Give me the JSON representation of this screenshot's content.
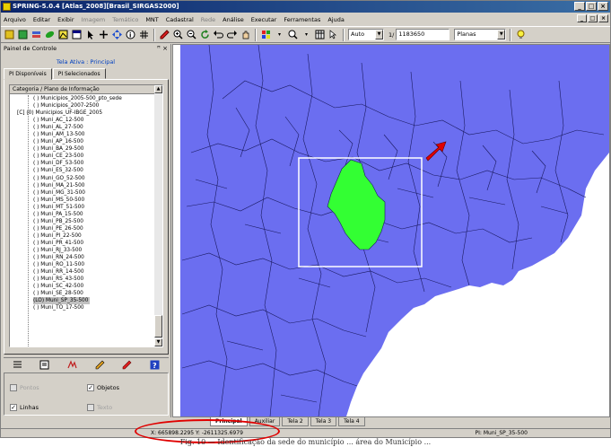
{
  "window": {
    "title": "SPRING-5.0.4 [Atlas_2008][Brasil_SIRGAS2000]",
    "controls": [
      "_",
      "□",
      "×"
    ],
    "mdi_controls": [
      "_",
      "□",
      "×"
    ]
  },
  "menu": [
    "Arquivo",
    "Editar",
    "Exibir",
    "Imagem",
    "Temático",
    "MNT",
    "Cadastral",
    "Rede",
    "Análise",
    "Executar",
    "Ferramentas",
    "Ajuda"
  ],
  "menu_disabled": [
    false,
    false,
    false,
    true,
    true,
    false,
    false,
    true,
    false,
    false,
    false,
    false
  ],
  "toolbar": {
    "mode_value": "Auto",
    "scale_prefix": "1/",
    "scale_value": "1183650",
    "view_value": "Planas"
  },
  "panel": {
    "title": "Painel de Controle",
    "pin": "ꟸ ×",
    "active_label": "Tela Ativa : Principal",
    "tabs": [
      "PI Disponíveis",
      "PI Selecionados"
    ],
    "tree_header": "Categoria / Plano de Informação",
    "tree_items": [
      {
        "label": "( ) Municipios_2005-500_pto_sede",
        "indent": 1,
        "selected": false
      },
      {
        "label": "( ) Municipios_2007-2500",
        "indent": 1,
        "selected": false
      },
      {
        "label": "[C] (0) Municipios_UF-IBGE_2005",
        "indent": 0,
        "selected": false
      },
      {
        "label": "( ) Muni_AC_12-500",
        "indent": 1,
        "selected": false
      },
      {
        "label": "( ) Muni_AL_27-500",
        "indent": 1,
        "selected": false
      },
      {
        "label": "( ) Muni_AM_13-500",
        "indent": 1,
        "selected": false
      },
      {
        "label": "( ) Muni_AP_16-500",
        "indent": 1,
        "selected": false
      },
      {
        "label": "( ) Muni_BA_29-500",
        "indent": 1,
        "selected": false
      },
      {
        "label": "( ) Muni_CE_23-500",
        "indent": 1,
        "selected": false
      },
      {
        "label": "( ) Muni_DF_53-500",
        "indent": 1,
        "selected": false
      },
      {
        "label": "( ) Muni_ES_32-500",
        "indent": 1,
        "selected": false
      },
      {
        "label": "( ) Muni_GO_52-500",
        "indent": 1,
        "selected": false
      },
      {
        "label": "( ) Muni_MA_21-500",
        "indent": 1,
        "selected": false
      },
      {
        "label": "( ) Muni_MG_31-500",
        "indent": 1,
        "selected": false
      },
      {
        "label": "( ) Muni_MS_50-500",
        "indent": 1,
        "selected": false
      },
      {
        "label": "( ) Muni_MT_51-500",
        "indent": 1,
        "selected": false
      },
      {
        "label": "( ) Muni_PA_15-500",
        "indent": 1,
        "selected": false
      },
      {
        "label": "( ) Muni_PB_25-500",
        "indent": 1,
        "selected": false
      },
      {
        "label": "( ) Muni_PE_26-500",
        "indent": 1,
        "selected": false
      },
      {
        "label": "( ) Muni_PI_22-500",
        "indent": 1,
        "selected": false
      },
      {
        "label": "( ) Muni_PR_41-500",
        "indent": 1,
        "selected": false
      },
      {
        "label": "( ) Muni_RJ_33-500",
        "indent": 1,
        "selected": false
      },
      {
        "label": "( ) Muni_RN_24-500",
        "indent": 1,
        "selected": false
      },
      {
        "label": "( ) Muni_RO_11-500",
        "indent": 1,
        "selected": false
      },
      {
        "label": "( ) Muni_RR_14-500",
        "indent": 1,
        "selected": false
      },
      {
        "label": "( ) Muni_RS_43-500",
        "indent": 1,
        "selected": false
      },
      {
        "label": "( ) Muni_SC_42-500",
        "indent": 1,
        "selected": false
      },
      {
        "label": "( ) Muni_SE_28-500",
        "indent": 1,
        "selected": false
      },
      {
        "label": "(LO) Muni_SP_35-500",
        "indent": 1,
        "selected": true
      },
      {
        "label": "( ) Muni_TO_17-500",
        "indent": 1,
        "selected": false
      }
    ],
    "checkboxes": {
      "pontos": {
        "label": "Pontos",
        "checked": false,
        "enabled": false
      },
      "objetos": {
        "label": "Objetos",
        "checked": true,
        "enabled": true
      },
      "linhas": {
        "label": "Linhas",
        "checked": true,
        "enabled": true
      },
      "texto": {
        "label": "Texto",
        "checked": false,
        "enabled": false
      }
    }
  },
  "map": {
    "fill_color": "#6b6ef0",
    "highlight_color": "#33ff33",
    "selection_box_color": "#ffffff",
    "arrow_color": "#e00000",
    "tabs": [
      "Principal",
      "Auxiliar",
      "Tela 2",
      "Tela 3",
      "Tela 4"
    ]
  },
  "status": {
    "coordinates": "X: 665898.2295  Y: -2611325.6979",
    "pi": "PI: Muni_SP_35-500"
  },
  "highlight_ring_color": "#e00000",
  "caption": "Fig. 10 — Identificação da sede do município ... área do Município ..."
}
